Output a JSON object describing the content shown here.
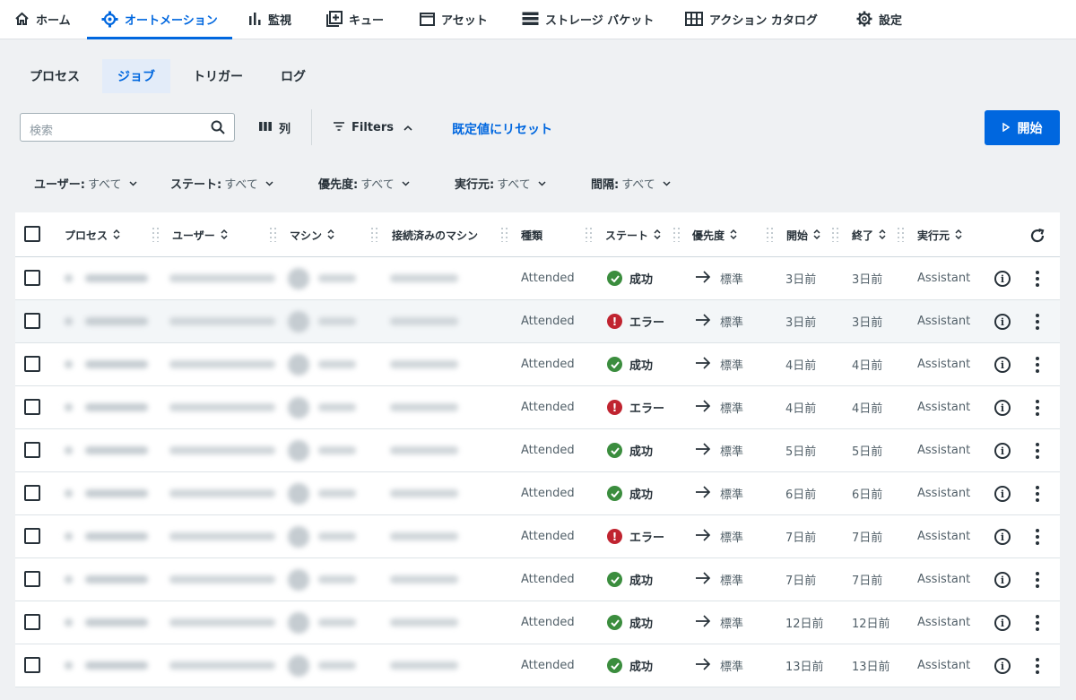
{
  "topnav": {
    "items": [
      {
        "label": "ホーム",
        "icon": "home-icon"
      },
      {
        "label": "オートメーション",
        "icon": "automation-gear-icon",
        "active": true
      },
      {
        "label": "監視",
        "icon": "bar-chart-icon"
      },
      {
        "label": "キュー",
        "icon": "queue-icon"
      },
      {
        "label": "アセット",
        "icon": "asset-icon"
      },
      {
        "label": "ストレージ バケット",
        "icon": "storage-bucket-icon"
      },
      {
        "label": "アクション カタログ",
        "icon": "action-catalog-icon"
      },
      {
        "label": "設定",
        "icon": "gear-icon"
      }
    ],
    "active_color": "#0067df"
  },
  "subtabs": [
    "プロセス",
    "ジョブ",
    "トリガー",
    "ログ"
  ],
  "active_subtab": "ジョブ",
  "toolbar": {
    "search_placeholder": "検索",
    "columns_label": "列",
    "filters_label": "Filters",
    "reset_label": "既定値にリセット",
    "start_label": "開始"
  },
  "filters": [
    {
      "label": "ユーザー:",
      "value": "すべて"
    },
    {
      "label": "ステート:",
      "value": "すべて"
    },
    {
      "label": "優先度:",
      "value": "すべて"
    },
    {
      "label": "実行元:",
      "value": "すべて"
    },
    {
      "label": "間隔:",
      "value": "すべて"
    }
  ],
  "table": {
    "headers": {
      "process": "プロセス",
      "user": "ユーザー",
      "machine": "マシン",
      "connected_machine": "接続済みのマシン",
      "type": "種類",
      "state": "ステート",
      "priority": "優先度",
      "start": "開始",
      "end": "終了",
      "source": "実行元"
    },
    "rows": [
      {
        "type": "Attended",
        "state": "成功",
        "status": "success",
        "priority": "標準",
        "start": "3日前",
        "end": "3日前",
        "source": "Assistant"
      },
      {
        "type": "Attended",
        "state": "エラー",
        "status": "error",
        "priority": "標準",
        "start": "3日前",
        "end": "3日前",
        "source": "Assistant"
      },
      {
        "type": "Attended",
        "state": "成功",
        "status": "success",
        "priority": "標準",
        "start": "4日前",
        "end": "4日前",
        "source": "Assistant"
      },
      {
        "type": "Attended",
        "state": "エラー",
        "status": "error",
        "priority": "標準",
        "start": "4日前",
        "end": "4日前",
        "source": "Assistant"
      },
      {
        "type": "Attended",
        "state": "成功",
        "status": "success",
        "priority": "標準",
        "start": "5日前",
        "end": "5日前",
        "source": "Assistant"
      },
      {
        "type": "Attended",
        "state": "成功",
        "status": "success",
        "priority": "標準",
        "start": "6日前",
        "end": "6日前",
        "source": "Assistant"
      },
      {
        "type": "Attended",
        "state": "エラー",
        "status": "error",
        "priority": "標準",
        "start": "7日前",
        "end": "7日前",
        "source": "Assistant"
      },
      {
        "type": "Attended",
        "state": "成功",
        "status": "success",
        "priority": "標準",
        "start": "7日前",
        "end": "7日前",
        "source": "Assistant"
      },
      {
        "type": "Attended",
        "state": "成功",
        "status": "success",
        "priority": "標準",
        "start": "12日前",
        "end": "12日前",
        "source": "Assistant"
      },
      {
        "type": "Attended",
        "state": "成功",
        "status": "success",
        "priority": "標準",
        "start": "13日前",
        "end": "13日前",
        "source": "Assistant"
      }
    ]
  },
  "colors": {
    "success": "#3b8d3e",
    "error": "#c02430",
    "primary": "#0067df"
  }
}
